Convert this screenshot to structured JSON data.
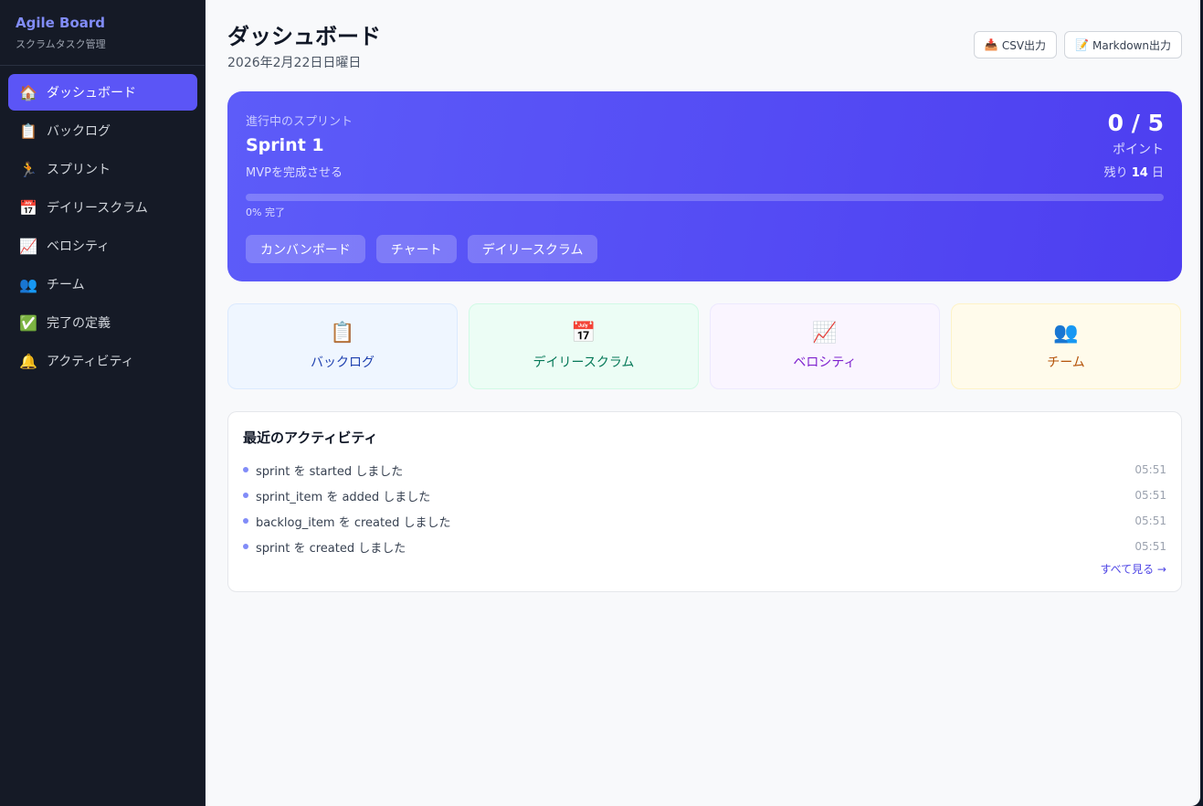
{
  "sidebar": {
    "brand_title": "Agile Board",
    "brand_subtitle": "スクラムタスク管理",
    "items": [
      {
        "label": "ダッシュボード",
        "icon": "🏠",
        "active": true
      },
      {
        "label": "バックログ",
        "icon": "📋"
      },
      {
        "label": "スプリント",
        "icon": "🏃"
      },
      {
        "label": "デイリースクラム",
        "icon": "📅"
      },
      {
        "label": "ベロシティ",
        "icon": "📈"
      },
      {
        "label": "チーム",
        "icon": "👥"
      },
      {
        "label": "完了の定義",
        "icon": "✅"
      },
      {
        "label": "アクティビティ",
        "icon": "🔔"
      }
    ]
  },
  "header": {
    "title": "ダッシュボード",
    "date": "2026年2月22日日曜日",
    "csv_icon": "📥",
    "csv_label": "CSV出力",
    "md_icon": "📝",
    "md_label": "Markdown出力"
  },
  "sprint": {
    "label": "進行中のスプリント",
    "name": "Sprint 1",
    "goal": "MVPを完成させる",
    "points": "0 / 5",
    "points_label": "ポイント",
    "remaining_prefix": "残り",
    "remaining_days": "14",
    "remaining_suffix": "日",
    "progress": 0,
    "progress_label": "0% 完了",
    "links": [
      "カンバンボード",
      "チャート",
      "デイリースクラム"
    ]
  },
  "quick_links": [
    {
      "label": "バックログ",
      "icon": "📋",
      "bg": "#eff6ff",
      "border": "#dbeafe",
      "color": "#1e40af"
    },
    {
      "label": "デイリースクラム",
      "icon": "📅",
      "bg": "#ecfdf5",
      "border": "#d1fae5",
      "color": "#047857"
    },
    {
      "label": "ベロシティ",
      "icon": "📈",
      "bg": "#faf5ff",
      "border": "#ede9fe",
      "color": "#7e22ce"
    },
    {
      "label": "チーム",
      "icon": "👥",
      "bg": "#fffbeb",
      "border": "#fef3c7",
      "color": "#b45309"
    }
  ],
  "activity": {
    "title": "最近のアクティビティ",
    "items": [
      {
        "text": "sprint を started しました",
        "time": "05:51"
      },
      {
        "text": "sprint_item を added しました",
        "time": "05:51"
      },
      {
        "text": "backlog_item を created しました",
        "time": "05:51"
      },
      {
        "text": "sprint を created しました",
        "time": "05:51"
      }
    ],
    "see_all": "すべて見る →"
  }
}
